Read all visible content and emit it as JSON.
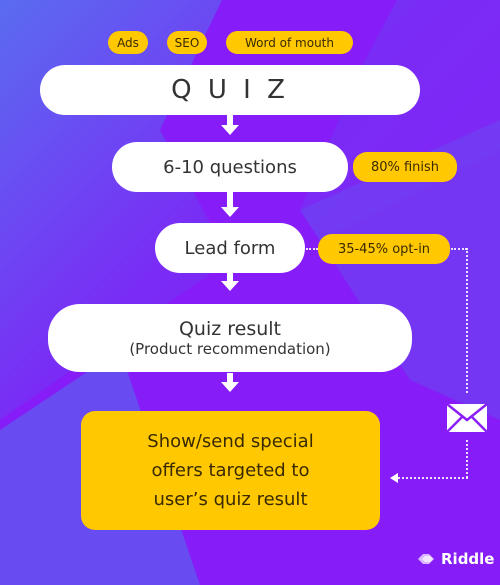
{
  "sources": [
    "Ads",
    "SEO",
    "Word of mouth"
  ],
  "steps": {
    "quiz": "Q U I Z",
    "questions": "6-10 questions",
    "lead_form": "Lead form",
    "result_title": "Quiz result",
    "result_subtitle": "(Product recommendation)",
    "offer_lines": [
      "Show/send special",
      "offers targeted to",
      "user’s quiz result"
    ]
  },
  "metrics": {
    "finish": "80% finish",
    "opt_in": "35-45% opt-in"
  },
  "icons": {
    "email": "envelope-icon",
    "logo": "riddle-logo-icon"
  },
  "brand": {
    "name": "Riddle"
  },
  "colors": {
    "accent": "#ffc800",
    "background": "#8a1ff8",
    "node": "#ffffff"
  }
}
